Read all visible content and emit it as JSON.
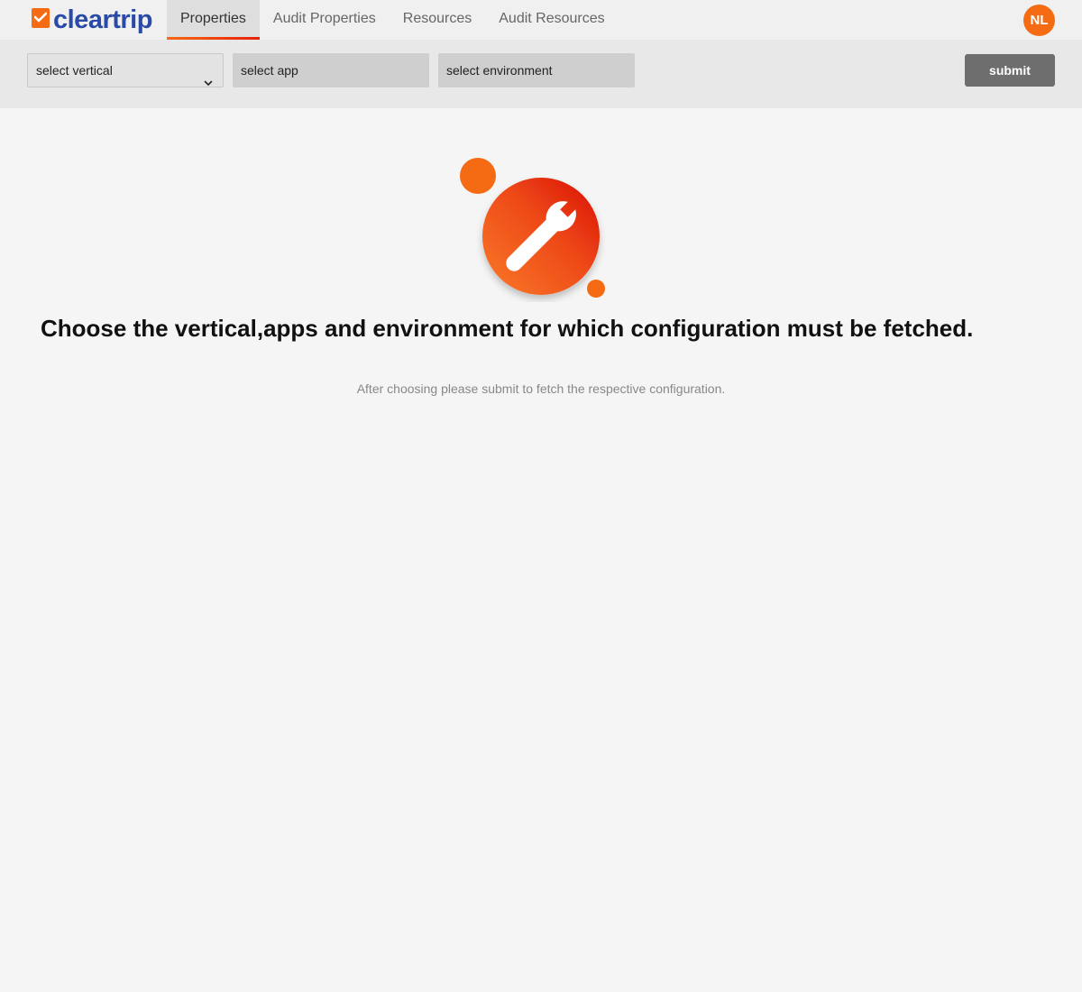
{
  "header": {
    "logo_text": "cleartrip",
    "tabs": [
      {
        "label": "Properties",
        "active": true
      },
      {
        "label": "Audit Properties",
        "active": false
      },
      {
        "label": "Resources",
        "active": false
      },
      {
        "label": "Audit Resources",
        "active": false
      }
    ],
    "avatar_initials": "NL"
  },
  "filters": {
    "vertical": {
      "value": "select vertical",
      "icon": "chevron-down-icon"
    },
    "app": {
      "value": "select app"
    },
    "environment": {
      "value": "select environment"
    },
    "submit_label": "submit"
  },
  "empty_state": {
    "icon": "wrench-icon",
    "heading": "Choose the vertical,apps and environment for which configuration must be fetched.",
    "subtext": "After choosing please submit to fetch the respective configuration."
  },
  "colors": {
    "brand_orange": "#f56b13",
    "brand_blue": "#2a4aa8",
    "accent_red": "#e0180a",
    "submit_bg": "#6e6e6e"
  }
}
